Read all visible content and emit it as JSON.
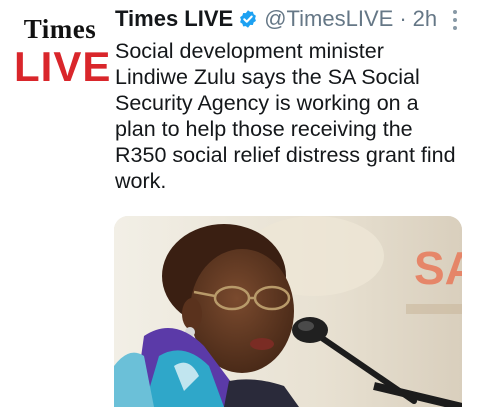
{
  "tweet": {
    "avatar": {
      "logo_top": "Times",
      "logo_bottom": "LIVE"
    },
    "display_name": "Times LIVE",
    "verified_icon": "verified-badge-icon",
    "handle": "@TimesLIVE",
    "separator": "·",
    "time": "2h",
    "more_icon": "more-vertical-icon",
    "text_lines": [
      "Social development minister",
      "Lindiwe Zulu says the SA Social",
      "Security Agency is working on a",
      "plan to help those receiving the",
      "R350 social relief distress grant find",
      "work."
    ],
    "colors": {
      "brand_red": "#d9262b",
      "verified_blue": "#1da1f2",
      "muted": "#657786",
      "text": "#14171a"
    }
  }
}
